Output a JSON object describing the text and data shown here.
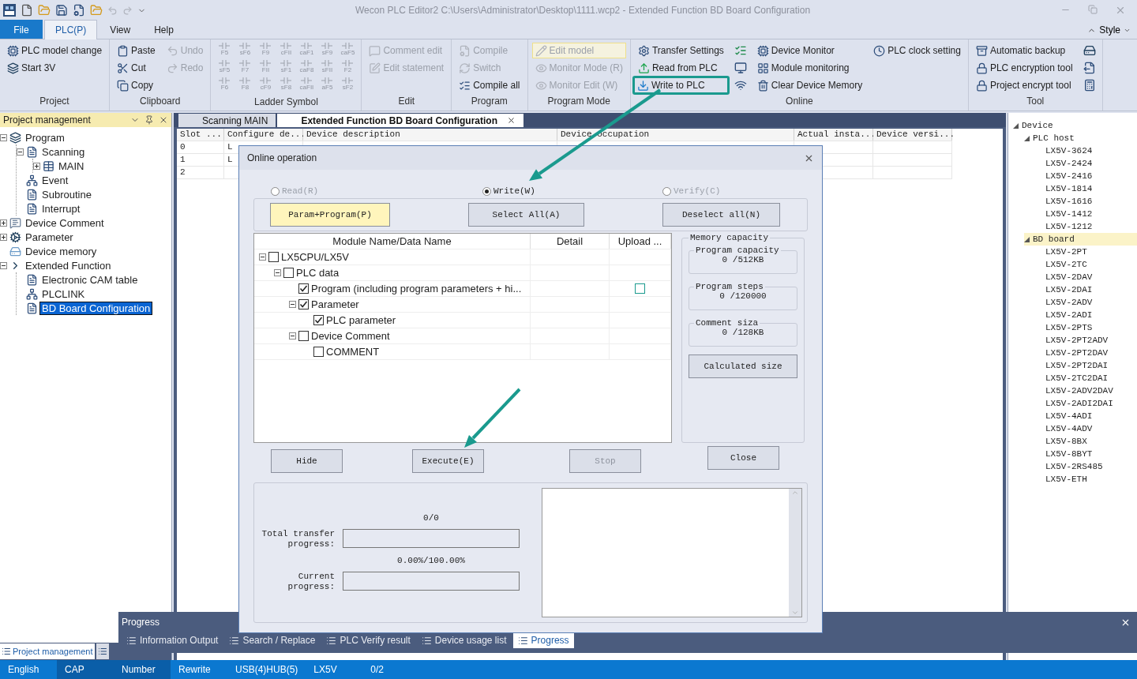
{
  "window": {
    "title": "Wecon PLC Editor2  C:\\Users\\Administrator\\Desktop\\1111.wcp2   - Extended Function BD Board Configuration"
  },
  "menu_tabs": [
    {
      "label": "File",
      "kind": "file",
      "selected": false
    },
    {
      "label": "PLC(P)",
      "kind": "tab",
      "selected": true
    },
    {
      "label": "View",
      "kind": "tab",
      "selected": false
    },
    {
      "label": "Help",
      "kind": "tab",
      "selected": false
    }
  ],
  "style_menu": "Style",
  "ribbon": [
    {
      "title": "Project",
      "columns": [
        {
          "kind": "buttons",
          "items": [
            {
              "label": "PLC model change",
              "disabled": false
            },
            {
              "label": "Start 3V",
              "disabled": false
            }
          ]
        }
      ]
    },
    {
      "title": "Clipboard",
      "columns": [
        {
          "kind": "buttons",
          "items": [
            {
              "label": "Paste",
              "disabled": false
            },
            {
              "label": "Cut",
              "disabled": false
            },
            {
              "label": "Copy",
              "disabled": false
            }
          ]
        },
        {
          "kind": "buttons",
          "items": [
            {
              "label": "Undo",
              "disabled": true
            },
            {
              "label": "Redo",
              "disabled": true
            }
          ]
        }
      ]
    },
    {
      "title": "Ladder Symbol",
      "columns": [
        {
          "kind": "symbols",
          "items": [
            {
              "label": "F5",
              "disabled": true
            },
            {
              "label": "sF6",
              "disabled": true
            },
            {
              "label": "F9",
              "disabled": true
            },
            {
              "label": "cFII",
              "disabled": true
            },
            {
              "label": "caF1",
              "disabled": true
            },
            {
              "label": "sF9",
              "disabled": true
            },
            {
              "label": "caF5",
              "disabled": true
            },
            {
              "label": "sF5",
              "disabled": true
            },
            {
              "label": "F7",
              "disabled": true
            },
            {
              "label": "FII",
              "disabled": true
            },
            {
              "label": "sF1",
              "disabled": true
            },
            {
              "label": "caF8",
              "disabled": true
            },
            {
              "label": "sFII",
              "disabled": true
            },
            {
              "label": "F2",
              "disabled": true
            },
            {
              "label": "F6",
              "disabled": true
            },
            {
              "label": "F8",
              "disabled": true
            },
            {
              "label": "cF9",
              "disabled": true
            },
            {
              "label": "sF8",
              "disabled": true
            },
            {
              "label": "caFII",
              "disabled": true
            },
            {
              "label": "aF5",
              "disabled": true
            },
            {
              "label": "sF2",
              "disabled": true
            }
          ]
        }
      ]
    },
    {
      "title": "Edit",
      "columns": [
        {
          "kind": "buttons",
          "items": [
            {
              "label": "Comment edit",
              "disabled": true
            },
            {
              "label": "Edit statement",
              "disabled": true
            }
          ]
        }
      ]
    },
    {
      "title": "Program",
      "columns": [
        {
          "kind": "buttons",
          "items": [
            {
              "label": "Compile",
              "disabled": true
            },
            {
              "label": "Switch",
              "disabled": true
            },
            {
              "label": "Compile all",
              "disabled": false
            }
          ]
        }
      ]
    },
    {
      "title": "Program Mode",
      "columns": [
        {
          "kind": "buttons",
          "items": [
            {
              "label": "Edit model",
              "disabled": true,
              "hovered": true
            },
            {
              "label": "Monitor Mode (R)",
              "disabled": true
            },
            {
              "label": "Monitor Edit (W)",
              "disabled": true
            }
          ]
        }
      ]
    },
    {
      "title": "Online",
      "columns": [
        {
          "kind": "buttons",
          "items": [
            {
              "label": "Transfer Settings",
              "disabled": false
            },
            {
              "label": "Read from PLC",
              "disabled": false
            },
            {
              "label": "Write to PLC",
              "disabled": false,
              "outlined": true
            }
          ]
        },
        {
          "kind": "icons",
          "items": [
            {
              "disabled": false
            },
            {
              "disabled": false
            },
            {
              "disabled": false
            }
          ]
        },
        {
          "kind": "buttons",
          "items": [
            {
              "label": "Device Monitor",
              "disabled": false
            },
            {
              "label": "Module monitoring",
              "disabled": false
            },
            {
              "label": "Clear Device Memory",
              "disabled": false
            }
          ]
        },
        {
          "kind": "buttons",
          "items": [
            {
              "label": "PLC clock setting",
              "disabled": false
            }
          ]
        }
      ]
    },
    {
      "title": "Tool",
      "columns": [
        {
          "kind": "buttons",
          "items": [
            {
              "label": "Automatic backup",
              "disabled": false
            },
            {
              "label": "PLC encryption tool",
              "disabled": false
            },
            {
              "label": "Project encrypt tool",
              "disabled": false
            }
          ]
        },
        {
          "kind": "icons",
          "items": [
            {
              "disabled": false
            },
            {
              "disabled": false
            },
            {
              "disabled": false
            }
          ]
        }
      ]
    }
  ],
  "project_panel": {
    "title": "Project management",
    "tree": [
      {
        "label": "Program",
        "expanded": true,
        "selected": false,
        "children": [
          {
            "label": "Scanning",
            "expanded": true,
            "selected": false,
            "children": [
              {
                "label": "MAIN",
                "expanded": false,
                "selected": false
              }
            ]
          },
          {
            "label": "Event",
            "selected": false
          },
          {
            "label": "Subroutine",
            "selected": false
          },
          {
            "label": "Interrupt",
            "selected": false
          }
        ]
      },
      {
        "label": "Device Comment",
        "expanded": false,
        "selected": false
      },
      {
        "label": "Parameter",
        "expanded": false,
        "selected": false
      },
      {
        "label": "Device memory",
        "selected": false
      },
      {
        "label": "Extended Function",
        "expanded": true,
        "selected": false,
        "children": [
          {
            "label": "Electronic CAM table",
            "selected": false
          },
          {
            "label": "PLCLINK",
            "selected": false
          },
          {
            "label": "BD Board Configuration",
            "selected": true
          }
        ]
      }
    ],
    "bottom_tabs": [
      {
        "label": "Project management",
        "selected": true
      },
      {
        "selected": false
      }
    ]
  },
  "doc_tabs": [
    {
      "label": "Scanning MAIN",
      "selected": false
    },
    {
      "label": "Extended Function BD Board Configuration",
      "selected": true
    }
  ],
  "table": {
    "columns": [
      "Slot ...",
      "Configure de...",
      "Device description",
      "Device occupation",
      "Actual insta...",
      "Device versi..."
    ],
    "rows": [
      [
        "0",
        "L"
      ],
      [
        "1",
        "L"
      ],
      [
        "2",
        ""
      ]
    ]
  },
  "device_panel": {
    "tree": [
      {
        "label": "Device",
        "expanded": true,
        "selected": false,
        "children": [
          {
            "label": "PLC host",
            "expanded": true,
            "selected": false,
            "children": [
              {
                "label": "LX5V-3624",
                "selected": false
              },
              {
                "label": "LX5V-2424",
                "selected": false
              },
              {
                "label": "LX5V-2416",
                "selected": false
              },
              {
                "label": "LX5V-1814",
                "selected": false
              },
              {
                "label": "LX5V-1616",
                "selected": false
              },
              {
                "label": "LX5V-1412",
                "selected": false
              },
              {
                "label": "LX5V-1212",
                "selected": false
              }
            ]
          },
          {
            "label": "BD board",
            "expanded": true,
            "selected": true,
            "children": [
              {
                "label": "LX5V-2PT",
                "selected": false
              },
              {
                "label": "LX5V-2TC",
                "selected": false
              },
              {
                "label": "LX5V-2DAV",
                "selected": false
              },
              {
                "label": "LX5V-2DAI",
                "selected": false
              },
              {
                "label": "LX5V-2ADV",
                "selected": false
              },
              {
                "label": "LX5V-2ADI",
                "selected": false
              },
              {
                "label": "LX5V-2PTS",
                "selected": false
              },
              {
                "label": "LX5V-2PT2ADV",
                "selected": false
              },
              {
                "label": "LX5V-2PT2DAV",
                "selected": false
              },
              {
                "label": "LX5V-2PT2DAI",
                "selected": false
              },
              {
                "label": "LX5V-2TC2DAI",
                "selected": false
              },
              {
                "label": "LX5V-2ADV2DAV",
                "selected": false
              },
              {
                "label": "LX5V-2ADI2DAI",
                "selected": false
              },
              {
                "label": "LX5V-4ADI",
                "selected": false
              },
              {
                "label": "LX5V-4ADV",
                "selected": false
              },
              {
                "label": "LX5V-8BX",
                "selected": false
              },
              {
                "label": "LX5V-8BYT",
                "selected": false
              },
              {
                "label": "LX5V-2RS485",
                "selected": false
              },
              {
                "label": "LX5V-ETH",
                "selected": false
              }
            ]
          }
        ]
      }
    ]
  },
  "dialog": {
    "title": "Online operation",
    "modes": [
      {
        "label": "Read(R)",
        "selected": false,
        "disabled": true
      },
      {
        "label": "Write(W)",
        "selected": true,
        "disabled": false
      },
      {
        "label": "Verify(C)",
        "selected": false,
        "disabled": true
      }
    ],
    "presets": [
      {
        "label": "Param+Program(P)",
        "highlighted": true
      },
      {
        "label": "Select All(A)",
        "highlighted": false
      },
      {
        "label": "Deselect all(N)",
        "highlighted": false
      }
    ],
    "tree_columns": [
      "Module Name/Data Name",
      "Detail",
      "Upload ..."
    ],
    "tree": [
      {
        "label": "LX5CPU/LX5V",
        "checked": false,
        "expanded": true,
        "children": [
          {
            "label": "PLC data",
            "checked": false,
            "expanded": true,
            "children": [
              {
                "label": "Program (including program parameters + hi...",
                "checked": true,
                "upload": false
              },
              {
                "label": "Parameter",
                "checked": true,
                "expanded": true,
                "children": [
                  {
                    "label": "PLC parameter",
                    "checked": true
                  }
                ]
              },
              {
                "label": "Device Comment",
                "checked": false,
                "expanded": true,
                "children": [
                  {
                    "label": "COMMENT",
                    "checked": false
                  }
                ]
              }
            ]
          }
        ]
      }
    ],
    "memory": {
      "title": "Memory capacity",
      "fields": [
        {
          "label": "Program capacity",
          "value": "0 /512KB"
        },
        {
          "label": "Program steps",
          "value": "0 /120000"
        },
        {
          "label": "Comment siza",
          "value": "0 /128KB"
        }
      ],
      "button": "Calculated size"
    },
    "actions": [
      {
        "label": "Hide",
        "disabled": false
      },
      {
        "label": "Execute(E)",
        "disabled": false
      },
      {
        "label": "Stop",
        "disabled": true
      },
      {
        "label": "Close",
        "disabled": false
      }
    ],
    "progress": {
      "count": "0/0",
      "total": {
        "label": "Total transfer progress:",
        "level": 0
      },
      "percent": "0.00%/100.00%",
      "current": {
        "label": "Current progress:",
        "level": 0
      }
    }
  },
  "output_panel": {
    "title": "Progress",
    "tabs": [
      {
        "label": "Information Output",
        "selected": false
      },
      {
        "label": "Search / Replace",
        "selected": false
      },
      {
        "label": "PLC Verify result",
        "selected": false
      },
      {
        "label": "Device usage list",
        "selected": false
      },
      {
        "label": "Progress",
        "selected": true
      }
    ]
  },
  "status_bar": [
    {
      "label": "English",
      "highlighted": false
    },
    {
      "label": "CAP",
      "highlighted": true
    },
    {
      "label": "Number",
      "highlighted": true
    },
    {
      "label": "Rewrite",
      "highlighted": false
    },
    {
      "label": "USB(4)HUB(5)",
      "highlighted": false
    },
    {
      "label": "LX5V",
      "highlighted": false
    },
    {
      "label": "0/2",
      "highlighted": false
    }
  ]
}
